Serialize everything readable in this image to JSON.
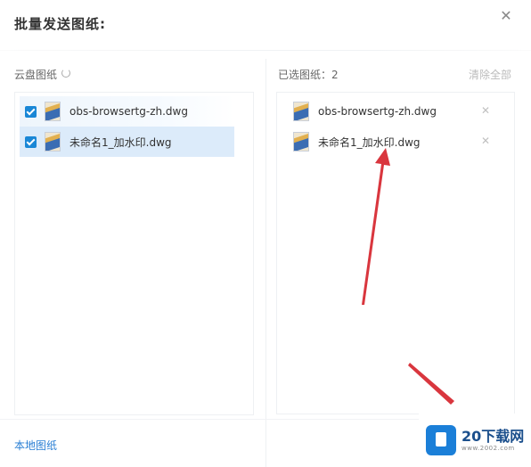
{
  "dialog": {
    "title": "批量发送图纸:",
    "close_icon": "close-icon"
  },
  "left": {
    "label": "云盘图纸",
    "refresh_icon": "refresh-icon",
    "files": [
      {
        "name": "obs-browsertg-zh.dwg",
        "checked": true
      },
      {
        "name": "未命名1_加水印.dwg",
        "checked": true
      }
    ],
    "local_link": "本地图纸"
  },
  "right": {
    "label": "已选图纸：2",
    "clear_all": "清除全部",
    "files": [
      {
        "name": "obs-browsertg-zh.dwg"
      },
      {
        "name": "未命名1_加水印.dwg"
      }
    ]
  },
  "watermark": {
    "brand": "20下载网",
    "domain": "www.2002.com"
  },
  "colors": {
    "accent": "#1a87d6",
    "selected_row": "#dcebfa",
    "annotation_arrow": "#d9363e"
  }
}
